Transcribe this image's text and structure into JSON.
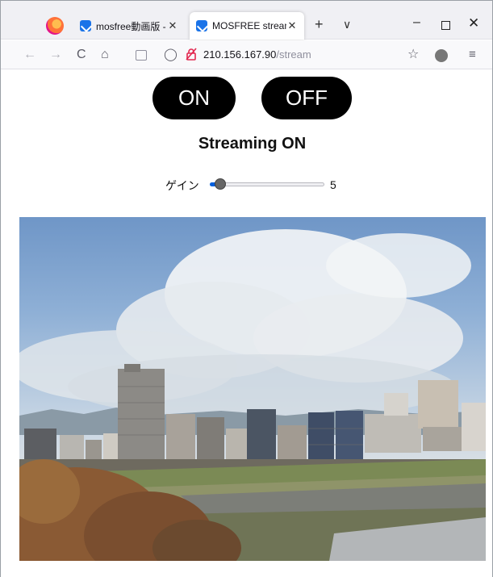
{
  "browser": {
    "tabs": [
      {
        "title": "mosfree動画版 - 秋",
        "active": false
      },
      {
        "title": "MOSFREE stream",
        "active": true
      }
    ],
    "url_host": "210.156.167.90",
    "url_path": "/stream",
    "icons": {
      "new_tab": "+",
      "tab_list": "∨",
      "minimize": "–",
      "close": "✕",
      "back": "←",
      "forward": "→",
      "reload": "C",
      "home": "⌂",
      "shield": "◯",
      "lock": "🔒",
      "star": "☆",
      "menu": "≡"
    }
  },
  "page": {
    "on_label": "ON",
    "off_label": "OFF",
    "status_text": "Streaming ON",
    "gain_label": "ゲイン",
    "gain_value": "5",
    "gain_fraction": 0.05
  },
  "colors": {
    "button_bg": "#000000",
    "button_text": "#ffffff",
    "slider_accent": "#0060df"
  }
}
